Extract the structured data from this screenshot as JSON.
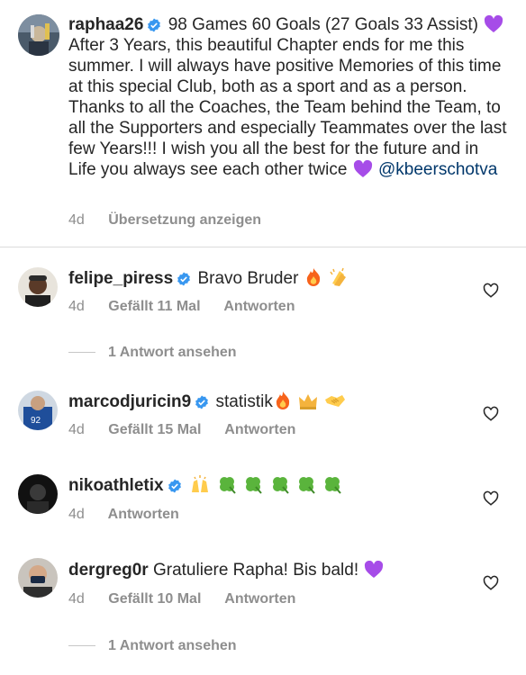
{
  "caption": {
    "username": "raphaa26",
    "text_line1": "98 Games 60 Goals (27 Goals 33 Assist)",
    "text_rest": "After 3 Years, this beautiful Chapter ends for me this summer. I will always have positive Memories of this time at this special Club, both as a sport and as a person.  Thanks to all the Coaches, the Team behind the Team, to all the Supporters and especially Teammates over the last few Years!!! I wish you all the best for the future and in Life you always see each other twice",
    "mention": "@kbeerschotva",
    "time": "4d",
    "translate": "Übersetzung anzeigen"
  },
  "comments": [
    {
      "username": "felipe_piress",
      "verified": true,
      "text": "Bravo Bruder",
      "time": "4d",
      "likes": "Gefällt 11 Mal",
      "reply": "Antworten",
      "view_replies": "1 Antwort ansehen"
    },
    {
      "username": "marcodjuricin9",
      "verified": true,
      "text": "statistik",
      "time": "4d",
      "likes": "Gefällt 15 Mal",
      "reply": "Antworten"
    },
    {
      "username": "nikoathletix",
      "verified": true,
      "text": "",
      "time": "4d",
      "reply": "Antworten"
    },
    {
      "username": "dergreg0r",
      "verified": false,
      "text": "Gratuliere Rapha! Bis bald!",
      "time": "4d",
      "likes": "Gefällt 10 Mal",
      "reply": "Antworten",
      "view_replies": "1 Antwort ansehen"
    }
  ],
  "colors": {
    "text": "#262626",
    "secondary": "#8e8e8e",
    "verified": "#3897f0",
    "mention": "#00376b",
    "divider": "#dbdbdb"
  },
  "icons": [
    "verified-badge-icon",
    "heart-icon",
    "purple-heart-emoji",
    "fire-emoji",
    "clapping-hands-emoji",
    "crown-emoji",
    "handshake-emoji",
    "raising-hands-emoji",
    "shamrock-emoji"
  ]
}
